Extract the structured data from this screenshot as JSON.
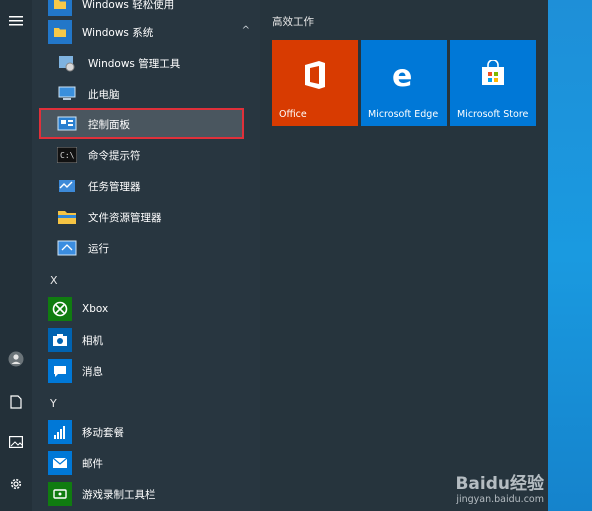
{
  "top_partial": "Windows 轻松使用",
  "group": {
    "label": "Windows 系统",
    "expanded_glyph": "^"
  },
  "sub_items": [
    {
      "label": "Windows 管理工具",
      "icon": "gear-tools-icon"
    },
    {
      "label": "此电脑",
      "icon": "computer-icon"
    },
    {
      "label": "控制面板",
      "icon": "control-panel-icon"
    },
    {
      "label": "命令提示符",
      "icon": "cmd-icon"
    },
    {
      "label": "任务管理器",
      "icon": "task-manager-icon"
    },
    {
      "label": "文件资源管理器",
      "icon": "folder-icon"
    },
    {
      "label": "运行",
      "icon": "run-icon"
    }
  ],
  "section_x": "X",
  "x_items": [
    {
      "label": "Xbox",
      "icon": "xbox-icon"
    },
    {
      "label": "相机",
      "icon": "camera-icon"
    },
    {
      "label": "消息",
      "icon": "message-icon"
    }
  ],
  "section_y": "Y",
  "y_items": [
    {
      "label": "移动套餐",
      "icon": "mobile-plan-icon"
    },
    {
      "label": "邮件",
      "icon": "mail-icon"
    },
    {
      "label": "游戏录制工具栏",
      "icon": "game-bar-icon"
    }
  ],
  "tiles_title": "高效工作",
  "tiles": [
    {
      "label": "Office",
      "color": "#d83b01"
    },
    {
      "label": "Microsoft Edge",
      "color": "#0078d7"
    },
    {
      "label": "Microsoft Store",
      "color": "#0078d7"
    }
  ],
  "watermark": {
    "brand": "Baidu经验",
    "url": "jingyan.baidu.com"
  }
}
